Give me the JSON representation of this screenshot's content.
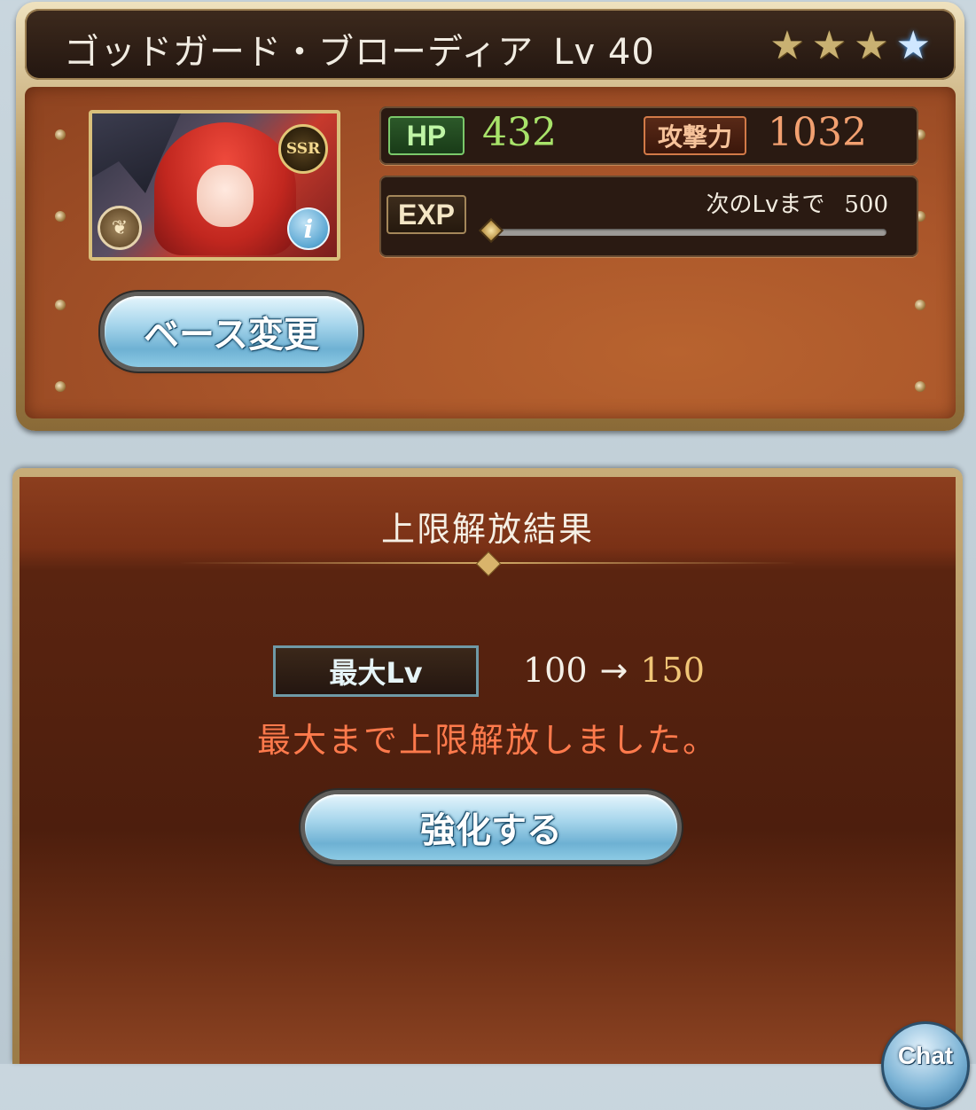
{
  "character": {
    "name": "ゴッドガード・ブローディア",
    "level": "Lv 40",
    "rarity": "SSR",
    "stars": [
      {
        "icon": "star-icon",
        "color": "#c9b172"
      },
      {
        "icon": "star-icon",
        "color": "#c9b172"
      },
      {
        "icon": "star-icon",
        "color": "#c9b172"
      },
      {
        "icon": "blue-star-icon",
        "color": "#4aa6ff"
      }
    ],
    "element_icon": "wind-element-icon",
    "info_icon": "info-icon"
  },
  "stats": {
    "hp_label": "HP",
    "hp_value": "432",
    "atk_label": "攻撃力",
    "atk_value": "1032",
    "exp_label": "EXP",
    "next_level_label": "次のLvまで",
    "next_level_value": "500",
    "exp_progress": 0.0
  },
  "buttons": {
    "change_base": "ベース変更",
    "enhance": "強化する",
    "chat": "Chat"
  },
  "result": {
    "title": "上限解放結果",
    "max_lv_label": "最大Lv",
    "max_lv_from": "100",
    "arrow": "→",
    "max_lv_to": "150",
    "message": "最大まで上限解放しました。"
  },
  "colors": {
    "hp_value": "#a8e36a",
    "atk_value": "#f2a070",
    "message": "#ff7a4c",
    "new_level": "#f0c677"
  }
}
